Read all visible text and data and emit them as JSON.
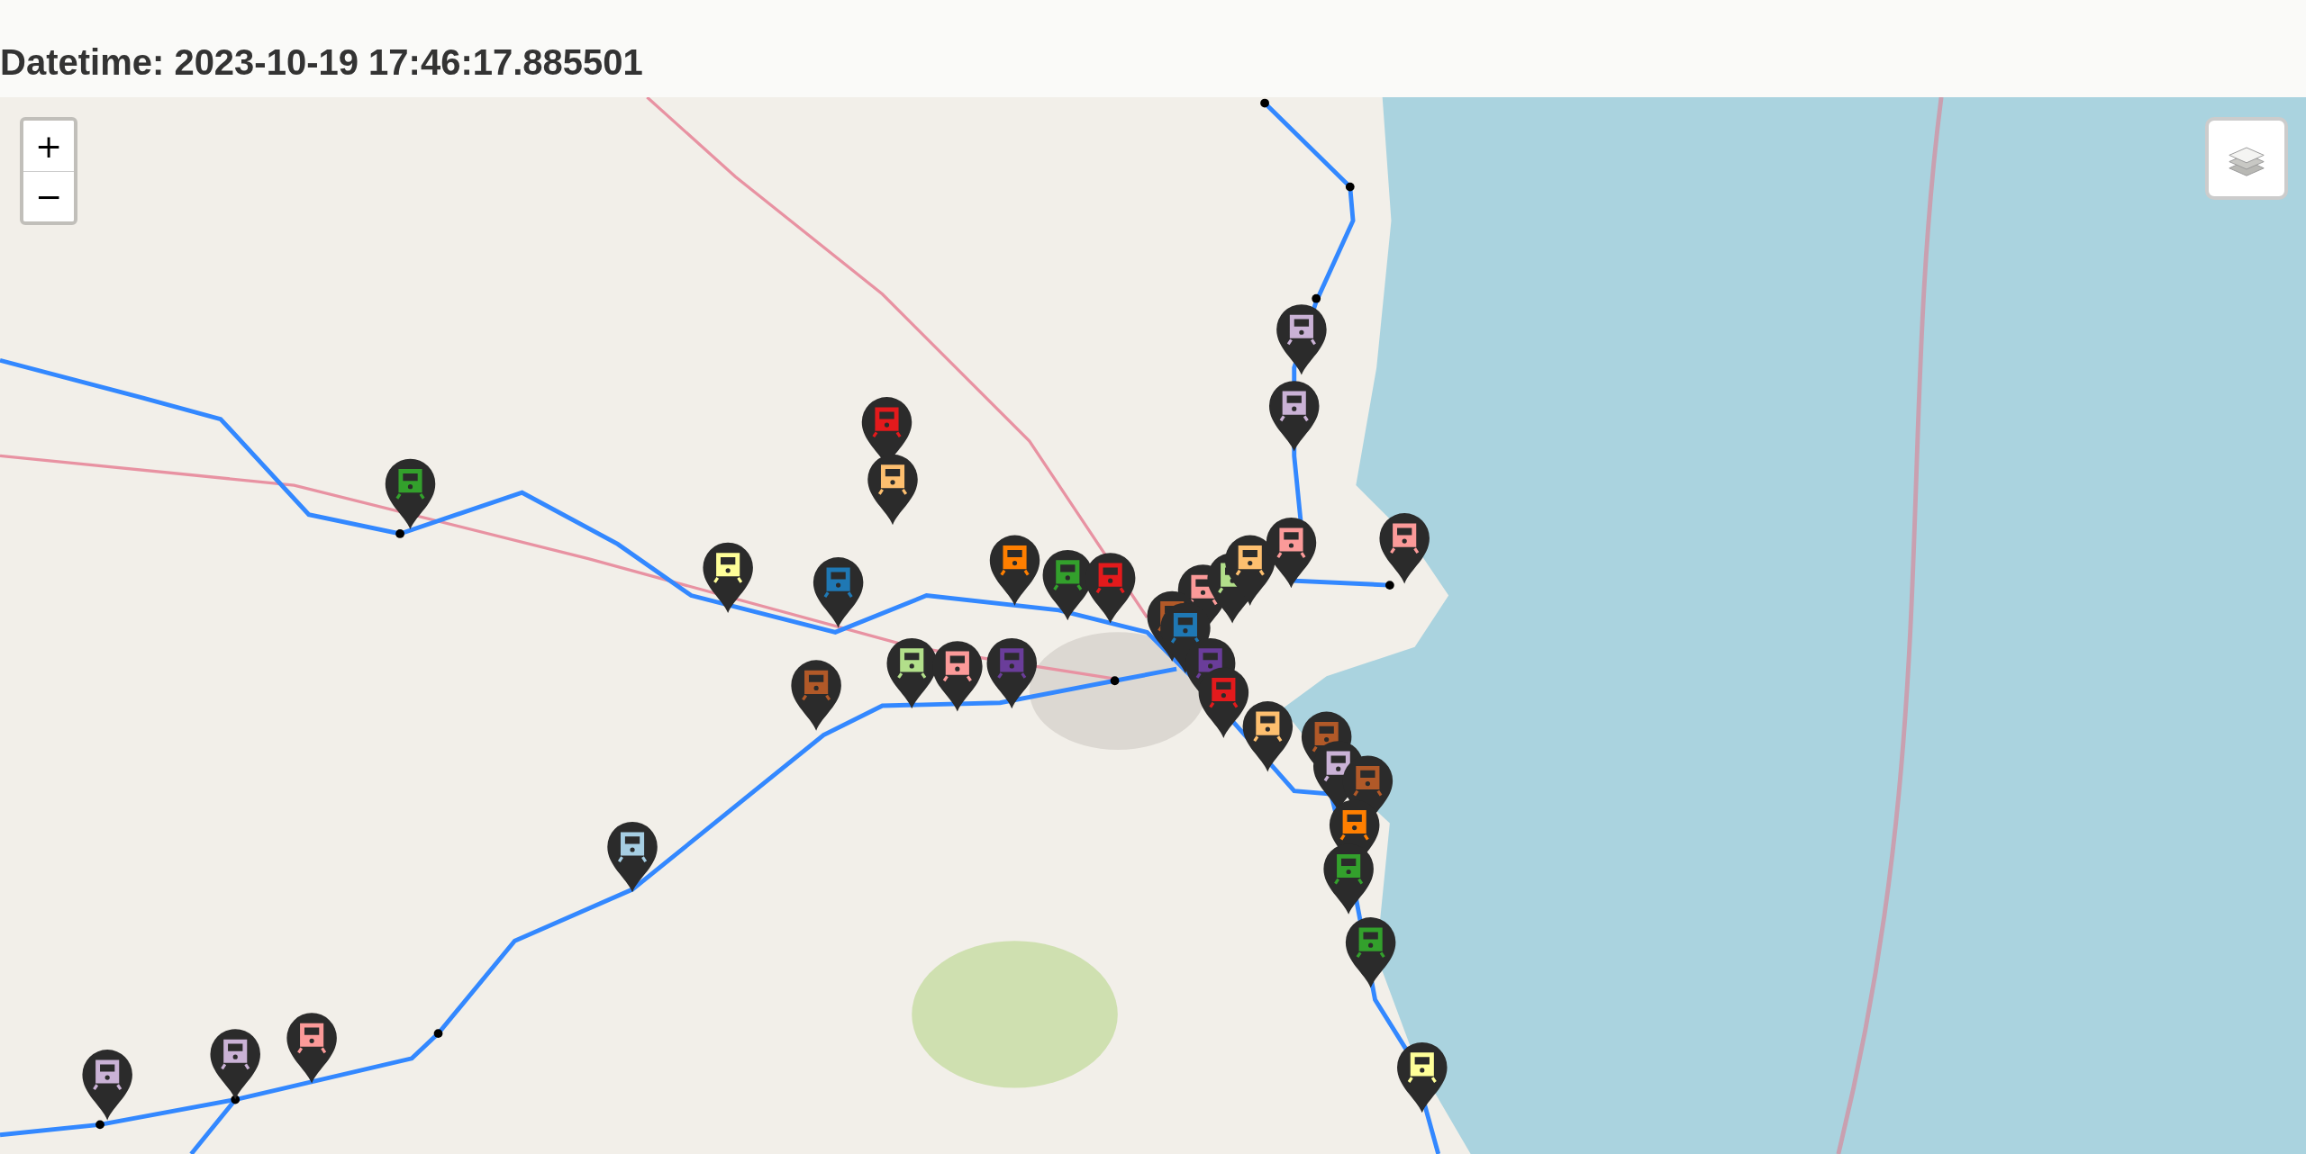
{
  "title": "Datetime: 2023-10-19 17:46:17.885501",
  "map": {
    "zoom_controls": [
      "+",
      "−"
    ],
    "markers": [
      {
        "color": "#cab2d6"
      },
      {
        "color": "#cab2d6"
      },
      {
        "color": "#e31a1c"
      },
      {
        "color": "#fdbf6f"
      },
      {
        "color": "#33a02c"
      },
      {
        "color": "#ffff99"
      },
      {
        "color": "#1f78b4"
      },
      {
        "color": "#ff7f00"
      },
      {
        "color": "#33a02c"
      },
      {
        "color": "#e31a1c"
      },
      {
        "color": "#fb9a99"
      },
      {
        "color": "#b2df8a"
      },
      {
        "color": "#fdbf6f"
      },
      {
        "color": "#fb9a99"
      },
      {
        "color": "#fb9a99"
      },
      {
        "color": "#b15928"
      },
      {
        "color": "#1f78b4"
      },
      {
        "color": "#6a3d9a"
      },
      {
        "color": "#e31a1c"
      },
      {
        "color": "#fdbf6f"
      },
      {
        "color": "#b15928"
      },
      {
        "color": "#cab2d6"
      },
      {
        "color": "#b15928"
      },
      {
        "color": "#ff7f00"
      },
      {
        "color": "#33a02c"
      },
      {
        "color": "#33a02c"
      },
      {
        "color": "#ffff99"
      },
      {
        "color": "#b2df8a"
      },
      {
        "color": "#fb9a99"
      },
      {
        "color": "#6a3d9a"
      },
      {
        "color": "#b15928"
      },
      {
        "color": "#a6cee3"
      },
      {
        "color": "#cab2d6"
      },
      {
        "color": "#cab2d6"
      },
      {
        "color": "#fb9a99"
      }
    ]
  }
}
